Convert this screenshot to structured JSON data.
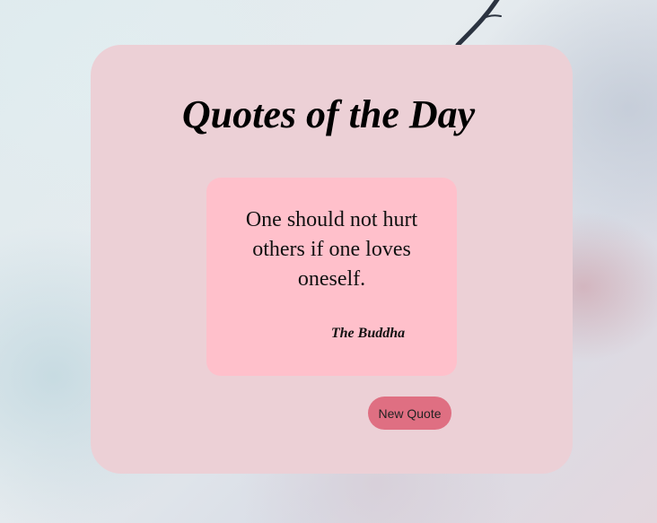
{
  "header": {
    "title": "Quotes of the Day"
  },
  "quote": {
    "text": "One should not hurt others if one loves oneself.",
    "author": "The Buddha"
  },
  "actions": {
    "new_quote_label": "New Quote"
  },
  "colors": {
    "card_background": "#ecd0d6",
    "quote_box_background": "#ffc0cb",
    "button_background": "#df6f82"
  }
}
